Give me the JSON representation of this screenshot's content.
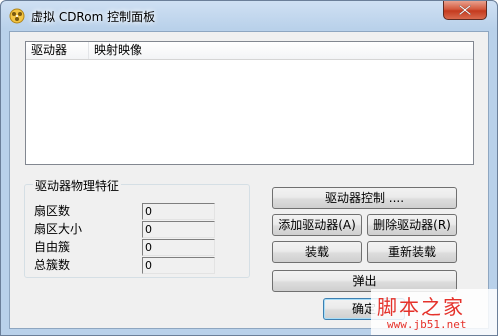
{
  "window": {
    "title": "虚拟 CDRom 控制面板"
  },
  "listview": {
    "columns": [
      "驱动器",
      "映射映像"
    ]
  },
  "properties": {
    "group_title": "驱动器物理特征",
    "rows": [
      {
        "label": "扇区数",
        "value": "0"
      },
      {
        "label": "扇区大小",
        "value": "0"
      },
      {
        "label": "自由簇",
        "value": "0"
      },
      {
        "label": "总簇数",
        "value": "0"
      }
    ]
  },
  "buttons": {
    "drive_control": "驱动器控制 ....",
    "add_drive": "添加驱动器(A)",
    "remove_drive": "删除驱动器(R)",
    "mount": "装载",
    "remount": "重新装载",
    "eject": "弹出",
    "ok": "确定"
  },
  "watermark": {
    "text": "脚本之家",
    "url": "www.jb51.net"
  },
  "colors": {
    "titlebar": "#b9d1ea",
    "close_button": "#c43a1e",
    "watermark": "#e5322b"
  }
}
